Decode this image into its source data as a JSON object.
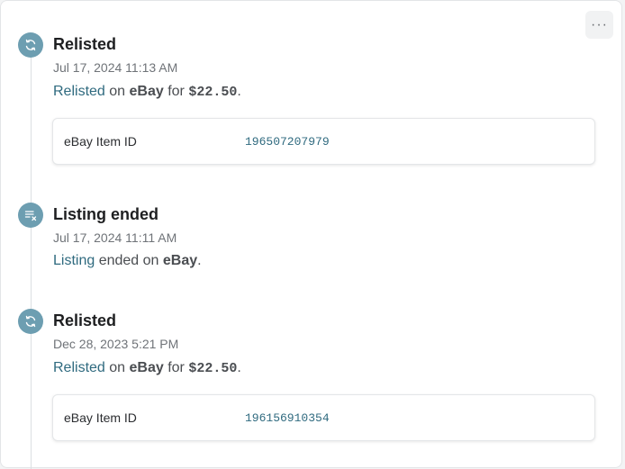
{
  "menu": {
    "more_label": "···"
  },
  "events": [
    {
      "icon": "relist-icon",
      "title": "Relisted",
      "date": "Jul 17, 2024 11:13 AM",
      "desc": {
        "link": "Relisted",
        "on": " on ",
        "marketplace": "eBay",
        "for": " for ",
        "price": "$22.50",
        "end": "."
      },
      "detail": {
        "label": "eBay Item ID",
        "value": "196507207979"
      }
    },
    {
      "icon": "listing-ended-icon",
      "title": "Listing ended",
      "date": "Jul 17, 2024 11:11 AM",
      "desc": {
        "link": "Listing",
        "on": " ended on ",
        "marketplace": "eBay",
        "end": "."
      }
    },
    {
      "icon": "relist-icon",
      "title": "Relisted",
      "date": "Dec 28, 2023 5:21 PM",
      "desc": {
        "link": "Relisted",
        "on": " on ",
        "marketplace": "eBay",
        "for": " for ",
        "price": "$22.50",
        "end": "."
      },
      "detail": {
        "label": "eBay Item ID",
        "value": "196156910354"
      }
    }
  ],
  "colors": {
    "accent": "#2f6a7f",
    "icon_bg": "#6d9eb1",
    "border": "#e4e6e8"
  }
}
